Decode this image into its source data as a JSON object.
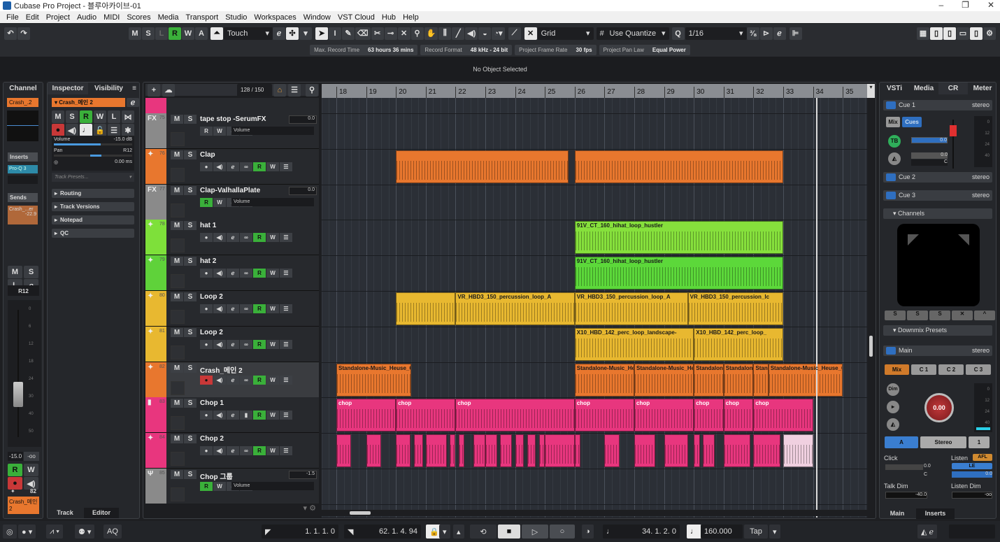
{
  "window": {
    "title": "Cubase Pro Project - 블루아카이브-01",
    "controls": [
      "–",
      "❐",
      "✕"
    ]
  },
  "menu": [
    "File",
    "Edit",
    "Project",
    "Audio",
    "MIDI",
    "Scores",
    "Media",
    "Transport",
    "Studio",
    "Workspaces",
    "Window",
    "VST Cloud",
    "Hub",
    "Help"
  ],
  "toolbar": {
    "undo": "↶",
    "redo": "↷",
    "states": [
      "M",
      "S",
      "L",
      "R",
      "W",
      "A"
    ],
    "automation_mode": "Touch",
    "snap_type": "Grid",
    "grid_type": "Use Quantize",
    "quantize": "1/16"
  },
  "info": [
    {
      "label": "Max. Record Time",
      "value": "63 hours 36 mins"
    },
    {
      "label": "Record Format",
      "value": "48 kHz - 24 bit"
    },
    {
      "label": "Project Frame Rate",
      "value": "30 fps"
    },
    {
      "label": "Project Pan Law",
      "value": "Equal Power"
    }
  ],
  "infoline": "No Object Selected",
  "channel": {
    "tab": "Channel",
    "name": "Crash_.2",
    "inserts": "Inserts",
    "insert1": "Pro-Q 3",
    "sends": "Sends",
    "send1": "Crash_...er",
    "send1_val": "-22.9",
    "pan": "R12",
    "fader_db": "-15.0",
    "peak": "-oo",
    "track_num": "82",
    "bottom_name": "Crash_메인 2",
    "scale": [
      "0",
      "6",
      "12",
      "18",
      "24",
      "30",
      "40",
      "50"
    ]
  },
  "inspector": {
    "tabs": [
      "Inspector",
      "Visibility"
    ],
    "track_name": "Crash_메인 2",
    "volume_label": "Volume",
    "volume": "-15.0 dB",
    "volume_level": 0.6,
    "pan_label": "Pan",
    "pan": "R12",
    "delay": "0.00 ms",
    "presets_placeholder": "Track Presets...",
    "sections": [
      "Routing",
      "Track Versions",
      "Notepad",
      "QC"
    ],
    "bottom_tabs": [
      "Track",
      "Editor"
    ]
  },
  "project": {
    "track_count": "128 / 150",
    "ruler_bars": [
      18,
      19,
      20,
      21,
      22,
      23,
      24,
      25,
      26,
      27,
      28,
      29,
      30,
      31,
      32,
      33,
      34,
      35
    ],
    "cursor_bar": 34.1
  },
  "tracks": [
    {
      "num": "75",
      "type": "FX",
      "name": "tape stop -SerumFX",
      "color": "#8a8a8a",
      "kind": "fx",
      "value": "0.0",
      "auto": "Volume"
    },
    {
      "num": "76",
      "type": "audio",
      "name": "Clap",
      "color": "#e8772e",
      "kind": "audio"
    },
    {
      "num": "77",
      "type": "FX",
      "name": "Clap-ValhallaPlate",
      "color": "#8a8a8a",
      "kind": "fx",
      "value": "0.0",
      "auto": "Volume"
    },
    {
      "num": "78",
      "type": "audio",
      "name": "hat 1",
      "color": "#7ee03a",
      "kind": "audio"
    },
    {
      "num": "79",
      "type": "audio",
      "name": "hat 2",
      "color": "#5fd23a",
      "kind": "audio"
    },
    {
      "num": "80",
      "type": "audio",
      "name": "Loop 2",
      "color": "#e8b830",
      "kind": "audio"
    },
    {
      "num": "81",
      "type": "audio",
      "name": "Loop 2",
      "color": "#e8b830",
      "kind": "audio"
    },
    {
      "num": "82",
      "type": "audio",
      "name": "Crash_메인 2",
      "color": "#e8772e",
      "kind": "audio",
      "selected": true
    },
    {
      "num": "83",
      "type": "sampler",
      "name": "Chop 1",
      "color": "#e8367e",
      "kind": "audio"
    },
    {
      "num": "84",
      "type": "audio",
      "name": "Chop 2",
      "color": "#e8367e",
      "kind": "audio"
    },
    {
      "num": "85",
      "type": "group",
      "name": "Chop 그룹",
      "color": "#8a8a8a",
      "kind": "fx",
      "value": "-1.5",
      "auto": "Volume"
    }
  ],
  "clips": [
    {
      "track": 1,
      "start": 20,
      "end": 25.8,
      "label": "",
      "color": "#e8772e"
    },
    {
      "track": 1,
      "start": 26,
      "end": 33,
      "label": "",
      "color": "#e8772e"
    },
    {
      "track": 3,
      "start": 26,
      "end": 33,
      "label": "91V_CT_160_hihat_loop_hustler",
      "color": "#86e03c"
    },
    {
      "track": 4,
      "start": 26,
      "end": 33,
      "label": "91V_CT_160_hihat_loop_hustler",
      "color": "#5cd83a"
    },
    {
      "track": 5,
      "start": 20,
      "end": 22,
      "label": "",
      "color": "#e8b830"
    },
    {
      "track": 5,
      "start": 22,
      "end": 26,
      "label": "VR_HBD3_150_percussion_loop_A",
      "color": "#e8b830"
    },
    {
      "track": 5,
      "start": 26,
      "end": 29.8,
      "label": "VR_HBD3_150_percussion_loop_A",
      "color": "#e8b830"
    },
    {
      "track": 5,
      "start": 29.8,
      "end": 33,
      "label": "VR_HBD3_150_percussion_lc",
      "color": "#e8b830"
    },
    {
      "track": 6,
      "start": 26,
      "end": 30,
      "label": "X10_HBD_142_perc_loop_landscape-",
      "color": "#e8b830"
    },
    {
      "track": 6,
      "start": 30,
      "end": 33,
      "label": "X10_HBD_142_perc_loop_",
      "color": "#e8b830"
    },
    {
      "track": 7,
      "start": 18,
      "end": 20.5,
      "label": "Standalone-Music_Heuse_C",
      "color": "#e8772e"
    },
    {
      "track": 7,
      "start": 26,
      "end": 28,
      "label": "Standalone-Music_He",
      "color": "#e8772e"
    },
    {
      "track": 7,
      "start": 28,
      "end": 30,
      "label": "Standalone-Music_He",
      "color": "#e8772e"
    },
    {
      "track": 7,
      "start": 30,
      "end": 31,
      "label": "Standalon",
      "color": "#e8772e"
    },
    {
      "track": 7,
      "start": 31,
      "end": 32,
      "label": "Standalon",
      "color": "#e8772e"
    },
    {
      "track": 7,
      "start": 32,
      "end": 32.5,
      "label": "Stan",
      "color": "#e8772e"
    },
    {
      "track": 7,
      "start": 32.5,
      "end": 35,
      "label": "Standalone-Music_Heuse_C",
      "color": "#e8772e"
    },
    {
      "track": 8,
      "start": 18,
      "end": 20,
      "label": "chop",
      "color": "#e8367e"
    },
    {
      "track": 8,
      "start": 20,
      "end": 22,
      "label": "chop",
      "color": "#e8367e"
    },
    {
      "track": 8,
      "start": 22,
      "end": 26,
      "label": "chop",
      "color": "#e8367e"
    },
    {
      "track": 8,
      "start": 26,
      "end": 28,
      "label": "chop",
      "color": "#e8367e"
    },
    {
      "track": 8,
      "start": 28,
      "end": 30,
      "label": "chop",
      "color": "#e8367e"
    },
    {
      "track": 8,
      "start": 30,
      "end": 31,
      "label": "chop",
      "color": "#e8367e"
    },
    {
      "track": 8,
      "start": 31,
      "end": 32,
      "label": "chop",
      "color": "#e8367e"
    },
    {
      "track": 8,
      "start": 32,
      "end": 34,
      "label": "chop",
      "color": "#e8367e"
    }
  ],
  "chop2_segments": [
    [
      18,
      18.5
    ],
    [
      19,
      19.5
    ],
    [
      20,
      20.5
    ],
    [
      20.6,
      20.9
    ],
    [
      21,
      21.7
    ],
    [
      21.8,
      22
    ],
    [
      22.1,
      22.3
    ],
    [
      22.6,
      23
    ],
    [
      23,
      23.4
    ],
    [
      23.5,
      23.9
    ],
    [
      24,
      24.3
    ],
    [
      24.4,
      24.7
    ],
    [
      24.8,
      25
    ],
    [
      25,
      26
    ],
    [
      26,
      26.2
    ],
    [
      27,
      27.5
    ],
    [
      28,
      28.7
    ],
    [
      29,
      29.8
    ],
    [
      30,
      30.2
    ],
    [
      30.3,
      30.7
    ],
    [
      31,
      31.9
    ],
    [
      32,
      32.9
    ],
    [
      33,
      34
    ]
  ],
  "right_panel": {
    "tabs": [
      "VSTi",
      "Media",
      "CR",
      "Meter"
    ],
    "cue1": "Cue 1",
    "cue2": "Cue 2",
    "cue3": "Cue 3",
    "stereo": "stereo",
    "mix": "Mix",
    "cues": "Cues",
    "tb": "TB",
    "cue_level": "0.0",
    "cue_pan_val": "0.0",
    "c": "C",
    "channels": "Channels",
    "downmix": "Downmix Presets",
    "main": "Main",
    "main_btns": [
      "Mix",
      "C 1",
      "C 2",
      "C 3"
    ],
    "dim": "Dim",
    "knob": "0.00",
    "out_a": "A",
    "out_stereo": "Stereo",
    "out_1": "1",
    "click": "Click",
    "click_val": "0.0",
    "listen": "Listen",
    "afl": "AFL",
    "le": "LE",
    "listen_val": "0.0",
    "talk_dim": "Talk Dim",
    "talk_dim_val": "-40.0",
    "listen_dim": "Listen Dim",
    "listen_dim_val": "-oo",
    "meter_scale": [
      "0",
      "12",
      "24",
      "40"
    ],
    "bottom_tabs": [
      "Main",
      "Inserts"
    ]
  },
  "transport": {
    "aq": "AQ",
    "left_locator": "1. 1. 1.   0",
    "right_locator": "62. 1. 4. 94",
    "position": "34. 1. 2.   0",
    "tempo": "160.000",
    "tap": "Tap"
  },
  "colors": {
    "accent_green": "#3ab03a",
    "record_red": "#c83838",
    "selected_orange": "#e8772e",
    "cr_blue": "#2f6fc0"
  }
}
